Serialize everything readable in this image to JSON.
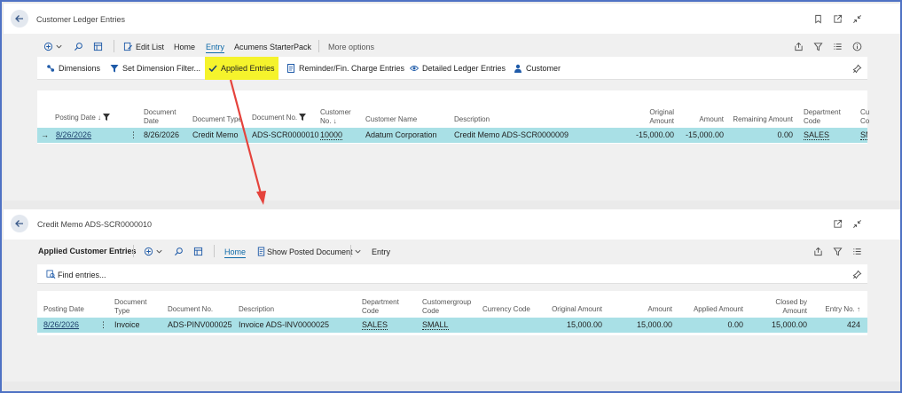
{
  "page1": {
    "title": "Customer Ledger Entries",
    "menu": {
      "edit_list": "Edit List",
      "home": "Home",
      "entry": "Entry",
      "acumens": "Acumens StarterPack",
      "more": "More options"
    },
    "actions": {
      "dimensions": "Dimensions",
      "set_dimension_filter": "Set Dimension Filter...",
      "applied_entries": "Applied Entries",
      "reminder": "Reminder/Fin. Charge Entries",
      "detailed": "Detailed Ledger Entries",
      "customer": "Customer"
    },
    "columns": {
      "posting_date": "Posting Date",
      "document_date_1": "Document",
      "document_date_2": "Date",
      "document_type": "Document Type",
      "document_no": "Document No.",
      "customer_no_1": "Customer",
      "customer_no_2": "No.",
      "customer_name": "Customer Name",
      "description": "Description",
      "original_amount_1": "Original",
      "original_amount_2": "Amount",
      "amount": "Amount",
      "remaining_amount": "Remaining Amount",
      "department_code_1": "Department",
      "department_code_2": "Code",
      "cut_1": "Cu",
      "cut_2": "Co"
    },
    "row": {
      "posting_date": "8/26/2026",
      "document_date": "8/26/2026",
      "document_type": "Credit Memo",
      "document_no": "ADS-SCR0000010",
      "customer_no": "10000",
      "customer_name": "Adatum Corporation",
      "description": "Credit Memo ADS-SCR0000009",
      "original_amount": "-15,000.00",
      "amount": "-15,000.00",
      "remaining_amount": "0.00",
      "department_code": "SALES",
      "cut": "SM"
    }
  },
  "page2": {
    "title": "Credit Memo ADS-SCR0000010",
    "menu": {
      "applied": "Applied Customer Entries",
      "home": "Home",
      "show_posted": "Show Posted Document",
      "entry": "Entry"
    },
    "find": "Find entries...",
    "columns": {
      "posting_date": "Posting Date",
      "document_type_1": "Document",
      "document_type_2": "Type",
      "document_no": "Document No.",
      "description": "Description",
      "department_code_1": "Department",
      "department_code_2": "Code",
      "customergroup_1": "Customergroup",
      "customergroup_2": "Code",
      "currency_code": "Currency Code",
      "original_amount": "Original Amount",
      "amount": "Amount",
      "applied_amount": "Applied Amount",
      "closed_by_1": "Closed by",
      "closed_by_2": "Amount",
      "entry_no": "Entry No."
    },
    "row": {
      "posting_date": "8/26/2026",
      "document_type": "Invoice",
      "document_no": "ADS-PINV000025",
      "description": "Invoice ADS-INV0000025",
      "department_code": "SALES",
      "customergroup_code": "SMALL",
      "currency_code": "",
      "original_amount": "15,000.00",
      "amount": "15,000.00",
      "applied_amount": "0.00",
      "closed_by_amount": "15,000.00",
      "entry_no": "424"
    }
  },
  "colors": {
    "accent": "#0e6aa8",
    "row_highlight": "#a9e0e6",
    "applied_highlight": "#f5f32c",
    "arrow": "#e5433c",
    "frame": "#4f72c4"
  }
}
